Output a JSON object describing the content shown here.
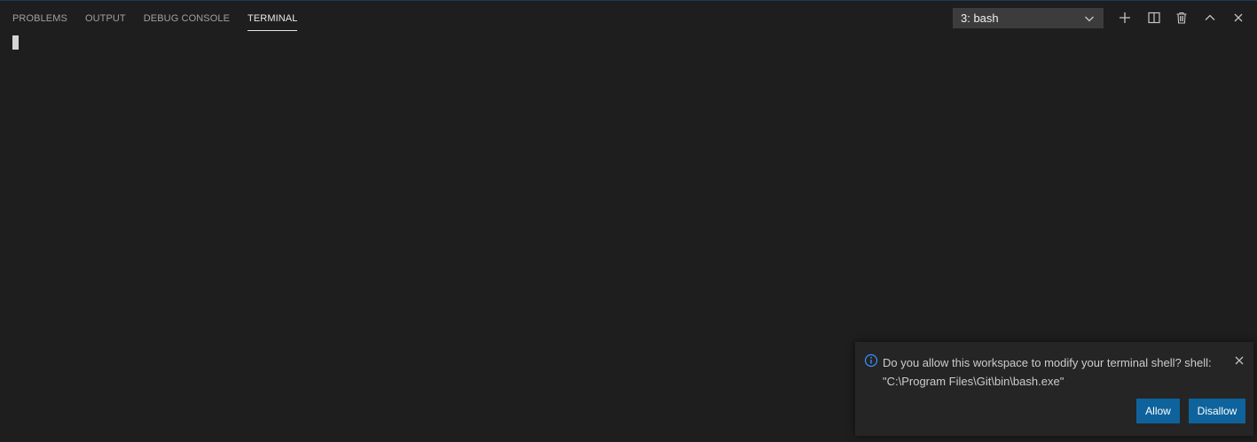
{
  "tabs": [
    {
      "label": "PROBLEMS"
    },
    {
      "label": "OUTPUT"
    },
    {
      "label": "DEBUG CONSOLE"
    },
    {
      "label": "TERMINAL"
    }
  ],
  "active_tab": "TERMINAL",
  "terminal_select": {
    "value": "3: bash",
    "icon": "chevron-down-icon"
  },
  "actions": {
    "new_terminal_icon": "plus-icon",
    "split_icon": "split-icon",
    "kill_icon": "trash-icon",
    "maximize_icon": "chevron-up-icon",
    "close_icon": "close-icon"
  },
  "notification": {
    "icon": "info-icon",
    "line1": "Do you allow this workspace to modify your terminal shell? shell:",
    "line2": "\"C:\\Program Files\\Git\\bin\\bash.exe\"",
    "allow_label": "Allow",
    "disallow_label": "Disallow"
  },
  "colors": {
    "background": "#1e1e1e",
    "button": "#0e639c",
    "info": "#3794ff"
  }
}
